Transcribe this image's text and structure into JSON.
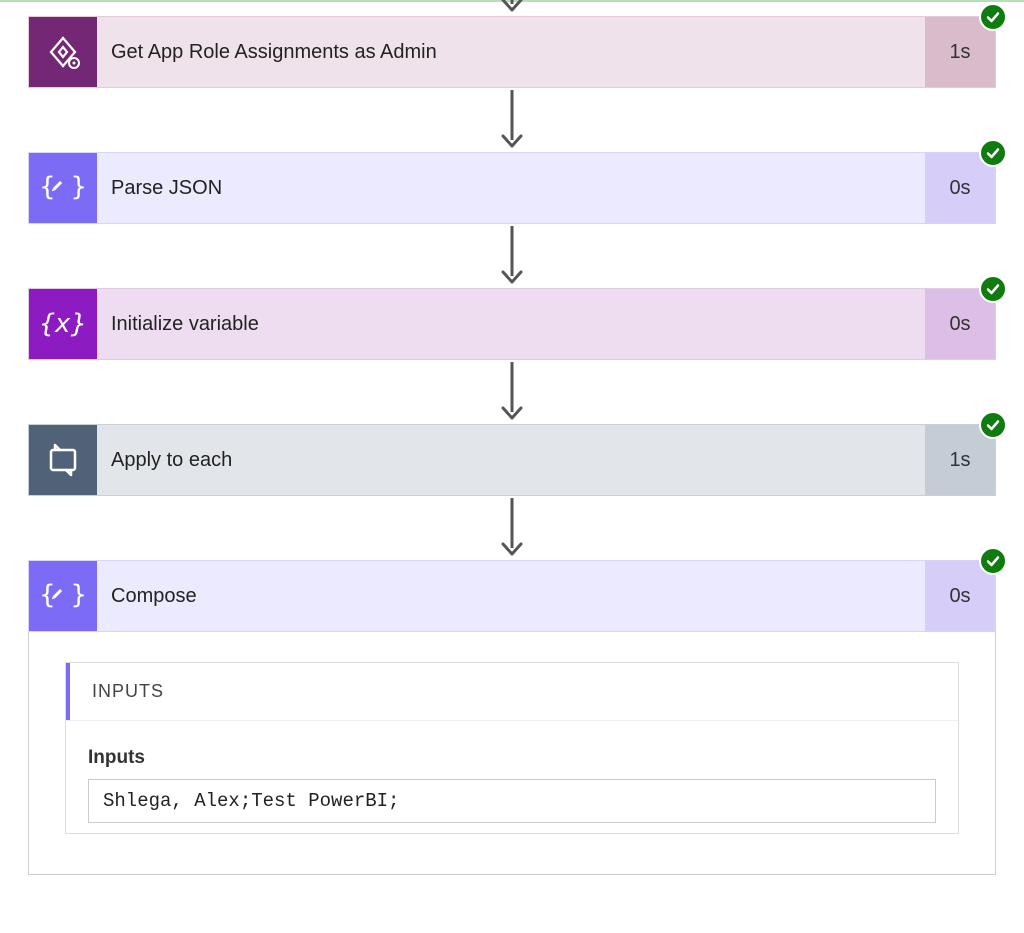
{
  "actions": [
    {
      "id": "get-app-role",
      "label": "Get App Role Assignments as Admin",
      "duration": "1s",
      "status": "success",
      "icon": "powerapps"
    },
    {
      "id": "parse-json",
      "label": "Parse JSON",
      "duration": "0s",
      "status": "success",
      "icon": "braces-edit"
    },
    {
      "id": "init-variable",
      "label": "Initialize variable",
      "duration": "0s",
      "status": "success",
      "icon": "braces-x"
    },
    {
      "id": "apply-to-each",
      "label": "Apply to each",
      "duration": "1s",
      "status": "success",
      "icon": "loop"
    },
    {
      "id": "compose",
      "label": "Compose",
      "duration": "0s",
      "status": "success",
      "icon": "braces-edit"
    }
  ],
  "compose_detail": {
    "section_title": "INPUTS",
    "field_label": "Inputs",
    "field_value": "Shlega, Alex;Test PowerBI;"
  }
}
